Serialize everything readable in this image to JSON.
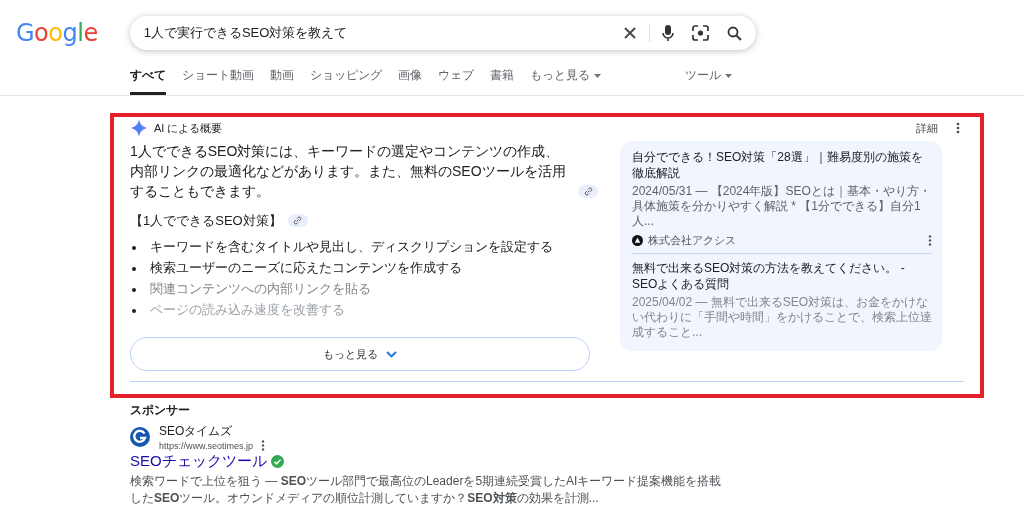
{
  "logo": "Google",
  "search": {
    "value": "1人で実行できるSEO対策を教えて"
  },
  "tabs": [
    {
      "label": "すべて",
      "selected": true
    },
    {
      "label": "ショート動画",
      "selected": false
    },
    {
      "label": "動画",
      "selected": false
    },
    {
      "label": "ショッピング",
      "selected": false
    },
    {
      "label": "画像",
      "selected": false
    },
    {
      "label": "ウェブ",
      "selected": false
    },
    {
      "label": "書籍",
      "selected": false
    },
    {
      "label": "もっと見る",
      "selected": false,
      "kind": "menu"
    }
  ],
  "tools": "ツール",
  "ai_overview": {
    "title": "AI による概要",
    "details": "詳細",
    "summary": "1人でできるSEO対策には、キーワードの選定やコンテンツの作成、内部リンクの最適化などがあります。また、無料のSEOツールを活用することもできます。",
    "heading": "【1人でできるSEO対策】",
    "bullets": [
      "キーワードを含むタイトルや見出し、ディスクリプションを設定する",
      "検索ユーザーのニーズに応えたコンテンツを作成する",
      "関連コンテンツへの内部リンクを貼る",
      "ページの読み込み速度を改善する"
    ],
    "sources": [
      {
        "title": "自分でできる！SEO対策「28選」｜難易度別の施策を徹底解説",
        "snippet": "2024/05/31 — 【2024年版】SEOとは｜基本・やり方・具体施策を分かりやすく解説 * 【1分でできる】自分1人...",
        "site": "株式会社アクシス"
      },
      {
        "title": "無料で出来るSEO対策の方法を教えてください。 - SEOよくある質問",
        "snippet": "2025/04/02 — 無料で出来るSEO対策は、お金をかけない代わりに「手間や時間」をかけることで、検索上位達成すること..."
      }
    ],
    "more_button": "もっと見る"
  },
  "sponsored": {
    "label": "スポンサー",
    "advertiser": "SEOタイムズ",
    "url": "https://www.seotimes.jp",
    "title": "SEOチェックツール",
    "verified": true,
    "description": "検索ワードで上位を狙う — **SEO**ツール部門で最高位のLeaderを5期連続受賞したAIキーワード提案機能を搭載した**SEO**ツール。オウンドメディアの順位計測していますか？**SEO対策**の効果を計測..."
  }
}
